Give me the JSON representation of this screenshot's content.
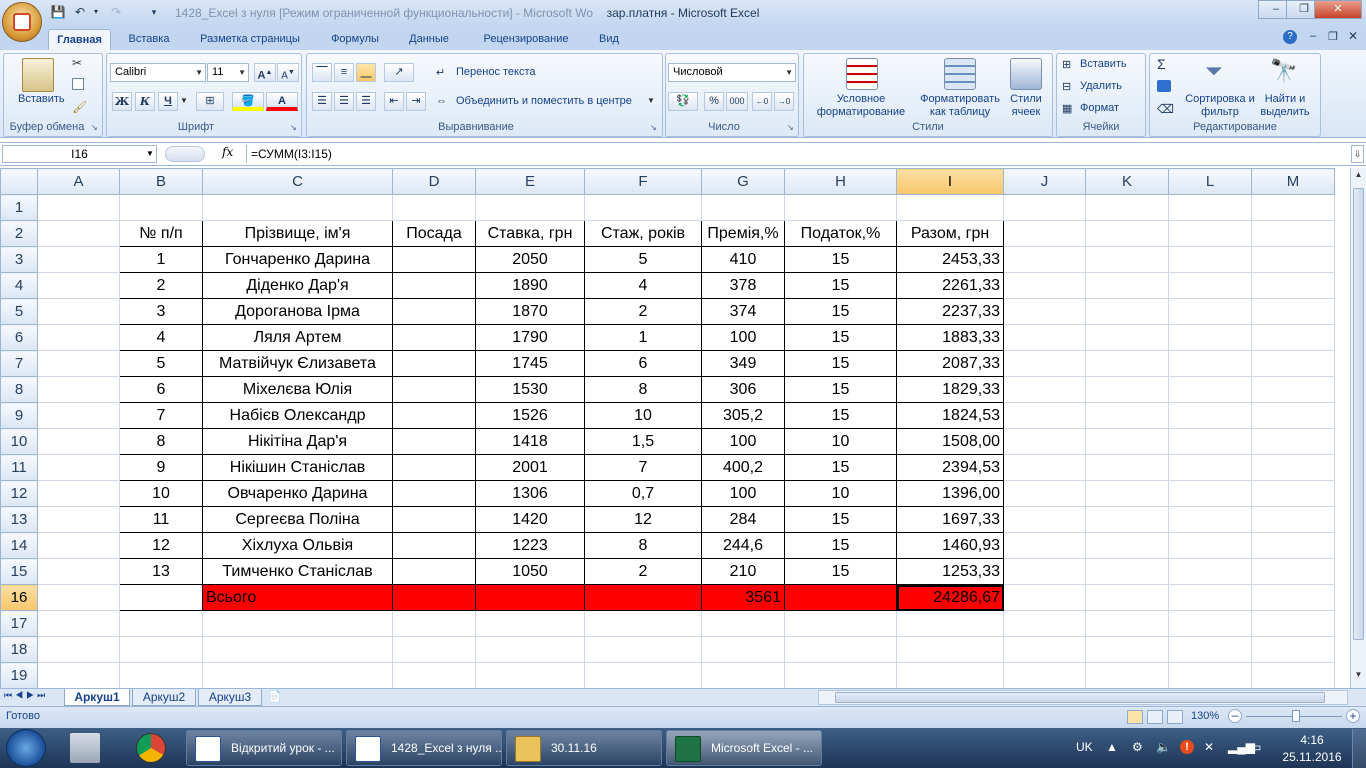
{
  "window": {
    "title": "зар.платня - Microsoft Excel",
    "faded_title": "1428_Excel з нуля [Режим ограниченной функциональности] - Microsoft Wo",
    "buttons": [
      "–",
      "❐",
      "✕"
    ]
  },
  "ribbon_tabs": [
    "Главная",
    "Вставка",
    "Разметка страницы",
    "Формулы",
    "Данные",
    "Рецензирование",
    "Вид"
  ],
  "ribbon": {
    "clipboard": {
      "paste": "Вставить",
      "label": "Буфер обмена"
    },
    "font": {
      "name": "Calibri",
      "size": "11",
      "bold": "Ж",
      "italic": "К",
      "underline": "Ч",
      "label": "Шрифт"
    },
    "alignment": {
      "wrap": "Перенос текста",
      "merge": "Объединить и поместить в центре",
      "label": "Выравнивание"
    },
    "number": {
      "format": "Числовой",
      "percent": "%",
      "thousands": "000",
      "label": "Число"
    },
    "styles": {
      "conditional": "Условное форматирование",
      "as_table": "Форматировать как таблицу",
      "cell_styles": "Стили ячеек",
      "label": "Стили"
    },
    "cells": {
      "insert": "Вставить",
      "delete": "Удалить",
      "format": "Формат",
      "label": "Ячейки"
    },
    "editing": {
      "sort": "Сортировка и фильтр",
      "find": "Найти и выделить",
      "label": "Редактирование"
    }
  },
  "formula_bar": {
    "name_box": "I16",
    "fx": "fx",
    "formula": "=СУММ(I3:I15)"
  },
  "columns": [
    "A",
    "B",
    "C",
    "D",
    "E",
    "F",
    "G",
    "H",
    "I",
    "J",
    "K",
    "L",
    "M"
  ],
  "selected_column": "I",
  "selected_row": "16",
  "headers": [
    "№ п/п",
    "Прізвище, ім'я",
    "Посада",
    "Ставка, грн",
    "Стаж, років",
    "Премія,%",
    "Податок,%",
    "Разом, грн"
  ],
  "rows": [
    [
      "1",
      "Гончаренко Дарина",
      "",
      "2050",
      "5",
      "410",
      "15",
      "2453,33"
    ],
    [
      "2",
      "Діденко Дар'я",
      "",
      "1890",
      "4",
      "378",
      "15",
      "2261,33"
    ],
    [
      "3",
      "Дороганова Ірма",
      "",
      "1870",
      "2",
      "374",
      "15",
      "2237,33"
    ],
    [
      "4",
      "Ляля Артем",
      "",
      "1790",
      "1",
      "100",
      "15",
      "1883,33"
    ],
    [
      "5",
      "Матвійчук Єлизавета",
      "",
      "1745",
      "6",
      "349",
      "15",
      "2087,33"
    ],
    [
      "6",
      "Міхелєва Юлія",
      "",
      "1530",
      "8",
      "306",
      "15",
      "1829,33"
    ],
    [
      "7",
      "Набієв Олександр",
      "",
      "1526",
      "10",
      "305,2",
      "15",
      "1824,53"
    ],
    [
      "8",
      "Нікітіна Дар'я",
      "",
      "1418",
      "1,5",
      "100",
      "10",
      "1508,00"
    ],
    [
      "9",
      "Нікішин Станіслав",
      "",
      "2001",
      "7",
      "400,2",
      "15",
      "2394,53"
    ],
    [
      "10",
      "Овчаренко Дарина",
      "",
      "1306",
      "0,7",
      "100",
      "10",
      "1396,00"
    ],
    [
      "11",
      "Сергеєва Поліна",
      "",
      "1420",
      "12",
      "284",
      "15",
      "1697,33"
    ],
    [
      "12",
      "Хіхлуха Ольвія",
      "",
      "1223",
      "8",
      "244,6",
      "15",
      "1460,93"
    ],
    [
      "13",
      "Тимченко Станіслав",
      "",
      "1050",
      "2",
      "210",
      "15",
      "1253,33"
    ]
  ],
  "total_row": {
    "label": "Всього",
    "premium_total": "3561",
    "grand_total": "24286,67"
  },
  "sheet_tabs": [
    "Аркуш1",
    "Аркуш2",
    "Аркуш3"
  ],
  "status": {
    "ready": "Готово",
    "zoom": "130%"
  },
  "taskbar": {
    "items": [
      "Відкритий урок - ...",
      "1428_Excel з нуля ...",
      "30.11.16",
      "Microsoft Excel - ..."
    ],
    "lang": "UK",
    "time": "4:16",
    "date": "25.11.2016"
  },
  "colors": {
    "accent": "#15428b",
    "red_fill": "#ff0000",
    "header_selected": "#f8c56b"
  }
}
